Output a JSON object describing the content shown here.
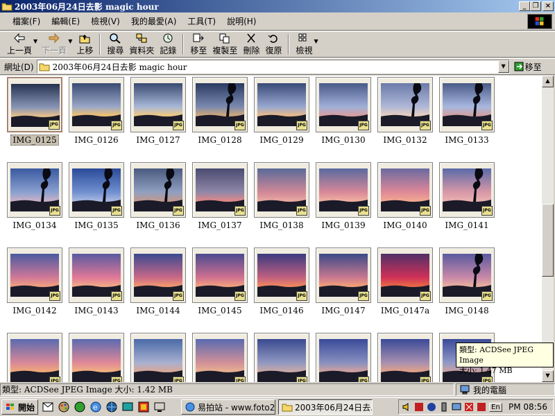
{
  "window": {
    "title": "2003年06月24日去影 magic hour",
    "buttons": {
      "minimize": "_",
      "maximize": "□",
      "restore": "❐",
      "close": "×"
    }
  },
  "menu": [
    "檔案(F)",
    "編輯(E)",
    "檢視(V)",
    "我的最愛(A)",
    "工具(T)",
    "說明(H)"
  ],
  "toolbar": {
    "back": "上一頁",
    "forward": "下一頁",
    "up": "上移",
    "search": "搜尋",
    "folders": "資料夾",
    "history": "記錄",
    "move_to": "移至",
    "copy_to": "複製至",
    "delete": "刪除",
    "undo": "復原",
    "views": "檢視"
  },
  "address": {
    "label": "網址(D)",
    "value": "2003年06月24日去影 magic hour",
    "go": "移至"
  },
  "files": [
    {
      "name": "IMG_0125",
      "selected": true
    },
    {
      "name": "IMG_0126"
    },
    {
      "name": "IMG_0127"
    },
    {
      "name": "IMG_0128"
    },
    {
      "name": "IMG_0129"
    },
    {
      "name": "IMG_0130"
    },
    {
      "name": "IMG_0132"
    },
    {
      "name": "IMG_0133"
    },
    {
      "name": "IMG_0134"
    },
    {
      "name": "IMG_0135"
    },
    {
      "name": "IMG_0136"
    },
    {
      "name": "IMG_0137"
    },
    {
      "name": "IMG_0138"
    },
    {
      "name": "IMG_0139"
    },
    {
      "name": "IMG_0140"
    },
    {
      "name": "IMG_0141"
    },
    {
      "name": "IMG_0142"
    },
    {
      "name": "IMG_0143"
    },
    {
      "name": "IMG_0144"
    },
    {
      "name": "IMG_0145"
    },
    {
      "name": "IMG_0146"
    },
    {
      "name": "IMG_0147"
    },
    {
      "name": "IMG_0147a"
    },
    {
      "name": "IMG_0148"
    },
    {
      "name": ""
    },
    {
      "name": ""
    },
    {
      "name": ""
    },
    {
      "name": ""
    },
    {
      "name": ""
    },
    {
      "name": ""
    },
    {
      "name": ""
    },
    {
      "name": ""
    }
  ],
  "badge_text": "JPG",
  "tooltip": {
    "type_line": "類型: ACDSee JPEG Image",
    "size_line": "大小: 1.47 MB"
  },
  "status": {
    "main": "類型: ACDSee JPEG Image 大小: 1.42 MB",
    "zone": "我的電腦"
  },
  "taskbar": {
    "start": "開始",
    "tasks": [
      {
        "label": "易拍站 - www.foto2...",
        "active": false
      },
      {
        "label": "2003年06月24日去...",
        "active": true
      }
    ],
    "tray_lang": "En",
    "clock": "PM 08:56"
  },
  "colors": {
    "title_start": "#0a246a",
    "title_end": "#a6caf0",
    "face": "#d4d0c8",
    "tooltip": "#ffffe1"
  }
}
